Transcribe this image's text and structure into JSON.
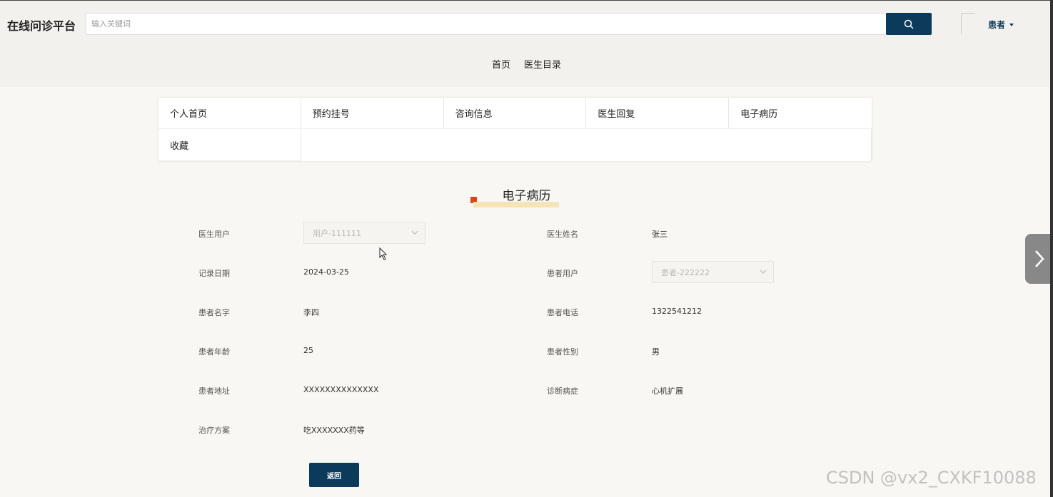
{
  "header": {
    "brand": "在线问诊平台",
    "search_placeholder": "输入关键词",
    "user_label": "患者"
  },
  "nav": [
    "首页",
    "医生目录"
  ],
  "menu": [
    "个人首页",
    "预约挂号",
    "咨询信息",
    "医生回复",
    "电子病历",
    "收藏"
  ],
  "section_title": "电子病历",
  "form": {
    "doctor_user_label": "医生用户",
    "doctor_user_value": "用户-111111",
    "doctor_name_label": "医生姓名",
    "doctor_name_value": "张三",
    "record_date_label": "记录日期",
    "record_date_value": "2024-03-25",
    "patient_user_label": "患者用户",
    "patient_user_value": "患者-222222",
    "patient_name_label": "患者名字",
    "patient_name_value": "李四",
    "patient_phone_label": "患者电话",
    "patient_phone_value": "1322541212",
    "patient_age_label": "患者年龄",
    "patient_age_value": "25",
    "patient_gender_label": "患者性别",
    "patient_gender_value": "男",
    "patient_address_label": "患者地址",
    "patient_address_value": "XXXXXXXXXXXXXX",
    "diagnosis_label": "诊断病症",
    "diagnosis_value": "心机扩展",
    "treatment_label": "治疗方案",
    "treatment_value": "吃XXXXXXX药等"
  },
  "back_label": "返回",
  "watermark": "CSDN @vx2_CXKF10088",
  "colors": {
    "primary": "#0b3a5b",
    "accent": "#d8461b",
    "page_bg": "#f8f7f3",
    "header_bg": "#f3f1ed"
  }
}
